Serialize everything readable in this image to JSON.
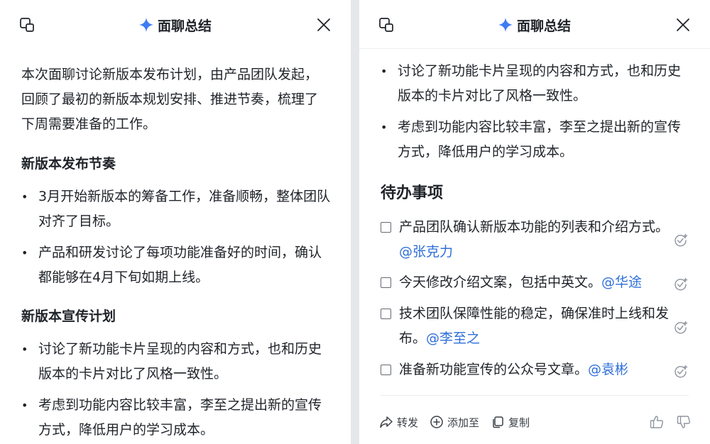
{
  "left_panel": {
    "header": {
      "title": "面聊总结",
      "icons": [
        "new-window-icon",
        "sparkle-icon",
        "close-icon"
      ]
    },
    "summary": "本次面聊讨论新版本发布计划，由产品团队发起，回顾了最初的新版本规划安排、推进节奏，梳理了下周需要准备的工作。",
    "sections": [
      {
        "heading": "新版本发布节奏",
        "bullets": [
          "3月开始新版本的筹备工作，准备顺畅，整体团队对齐了目标。",
          "产品和研发讨论了每项功能准备好的时间，确认都能够在4月下旬如期上线。"
        ]
      },
      {
        "heading": "新版本宣传计划",
        "bullets": [
          "讨论了新功能卡片呈现的内容和方式，也和历史版本的卡片对比了风格一致性。",
          "考虑到功能内容比较丰富，李至之提出新的宣传方式，降低用户的学习成本。"
        ]
      }
    ]
  },
  "right_panel": {
    "header": {
      "title": "面聊总结",
      "icons": [
        "new-window-icon",
        "sparkle-icon",
        "close-icon"
      ]
    },
    "bullets": [
      "讨论了新功能卡片呈现的内容和方式，也和历史版本的卡片对比了风格一致性。",
      "考虑到功能内容比较丰富，李至之提出新的宣传方式，降低用户的学习成本。"
    ],
    "todo_heading": "待办事项",
    "todos": [
      {
        "text": "产品团队确认新版本功能的列表和介绍方式。",
        "mention": "@张克力",
        "checked": false
      },
      {
        "text": "今天修改介绍文案，包括中英文。",
        "mention": "@华途",
        "checked": false
      },
      {
        "text": "技术团队保障性能的稳定，确保准时上线和发布。",
        "mention": "@李至之",
        "checked": false
      },
      {
        "text": "准备新功能宣传的公众号文章。",
        "mention": "@袁彬",
        "checked": false
      }
    ],
    "footer": {
      "forward": "转发",
      "add_to": "添加至",
      "copy": "复制",
      "icons": [
        "forward-icon",
        "add-circle-icon",
        "copy-icon",
        "thumbs-up-icon",
        "thumbs-down-icon"
      ]
    }
  },
  "colors": {
    "mention": "#2f6fd8",
    "sparkle": "#3d7cf5",
    "text": "#1f2329"
  }
}
